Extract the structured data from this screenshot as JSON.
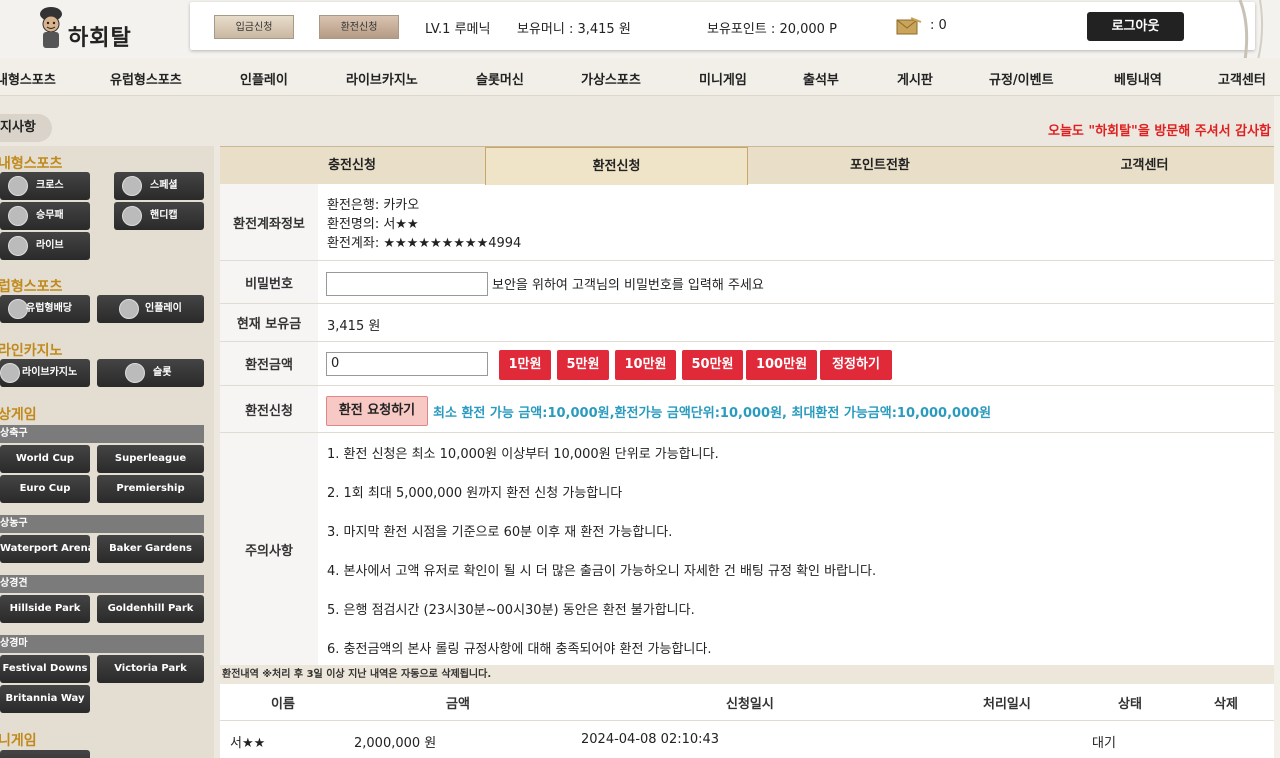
{
  "header": {
    "logo_text": "하회탈",
    "deposit_btn": "입금신청",
    "withdraw_btn": "환전신청",
    "level": "LV.1 루메닉",
    "money": "보유머니 : 3,415 원",
    "points": "보유포인트 : 20,000 P",
    "mail_count": ": 0",
    "logout": "로그아웃"
  },
  "nav": [
    "내형스포츠",
    "유럽형스포츠",
    "인플레이",
    "라이브카지노",
    "슬롯머신",
    "가상스포츠",
    "미니게임",
    "출석부",
    "게시판",
    "규정/이벤트",
    "베팅내역",
    "고객센터"
  ],
  "notice": {
    "label": "지사항",
    "marquee": "오늘도 \"하회탈\"을 방문해 주셔서 감사합"
  },
  "sidebar": {
    "sec1": "내형스포츠",
    "cross": "크로스",
    "special": "스페셜",
    "winlose": "승무패",
    "handicap": "핸디캡",
    "live": "라이브",
    "sec2": "럽형스포츠",
    "euro_dividend": "유럽형배당",
    "inplay": "인플레이",
    "sec3": "라인카지노",
    "live_casino": "라이브카지노",
    "slot": "슬롯",
    "sec4": "상게임",
    "soccer": "상축구",
    "world_cup": "World Cup",
    "superleague": "Superleague",
    "euro_cup": "Euro Cup",
    "premiership": "Premiership",
    "basketball": "상농구",
    "waterport": "Waterport Arena",
    "baker": "Baker Gardens",
    "racing": "상경견",
    "hillside": "Hillside Park",
    "goldenhill": "Goldenhill Park",
    "horse": "상경마",
    "festival": "Festival Downs",
    "victoria": "Victoria Park",
    "britannia": "Britannia Way",
    "sec5": "니게임"
  },
  "tabs": [
    "충전신청",
    "환전신청",
    "포인트전환",
    "고객센터"
  ],
  "form": {
    "account_label": "환전계좌정보",
    "bank": "환전은행: 카카오",
    "holder": "환전명의: 서★★",
    "account": "환전계좌: ★★★★★★★★★4994",
    "pwd_label": "비밀번호",
    "pwd_hint": "보안을 위하여 고객님의 비밀번호를 입력해 주세요",
    "balance_label": "현재 보유금",
    "balance": "3,415 원",
    "amount_label": "환전금액",
    "amount_value": "0",
    "amount_buttons": [
      "1만원",
      "5만원",
      "10만원",
      "50만원",
      "100만원",
      "정정하기"
    ],
    "request_label": "환전신청",
    "request_btn": "환전 요청하기",
    "minmax": "최소 환전 가능 금액:10,000원,환전가능 금액단위:10,000원, 최대환전 가능금액:10,000,000원",
    "notes_label": "주의사항",
    "notes": [
      "1. 환전 신청은 최소 10,000원 이상부터 10,000원 단위로 가능합니다.",
      "2. 1회 최대 5,000,000 원까지 환전 신청 가능합니다",
      "3. 마지막 환전 시점을 기준으로 60분 이후 재 환전 가능합니다.",
      "4. 본사에서 고액 유저로 확인이 될 시 더 많은 출금이 가능하오니 자세한 건 배팅 규정 확인 바랍니다.",
      "5. 은행 점검시간 (23시30분~00시30분) 동안은 환전 불가합니다.",
      "6. 충전금액의 본사 롤링 규정사항에 대해 충족되어야 환전 가능합니다."
    ]
  },
  "history": {
    "header": "환전내역 ※처리 후 3일 이상 지난 내역은 자동으로 삭제됩니다.",
    "columns": [
      "이름",
      "금액",
      "신청일시",
      "처리일시",
      "상태",
      "삭제"
    ],
    "rows": [
      {
        "name": "서★★",
        "amount": "2,000,000 원",
        "requested": "2024-04-08 02:10:43",
        "processed": "",
        "status": "대기",
        "delete": ""
      }
    ]
  },
  "colors": {
    "accent_gold": "#c08a1c",
    "red_button": "#e02a3a",
    "info_blue": "#2a9bbf",
    "notice_red": "#e02020"
  }
}
